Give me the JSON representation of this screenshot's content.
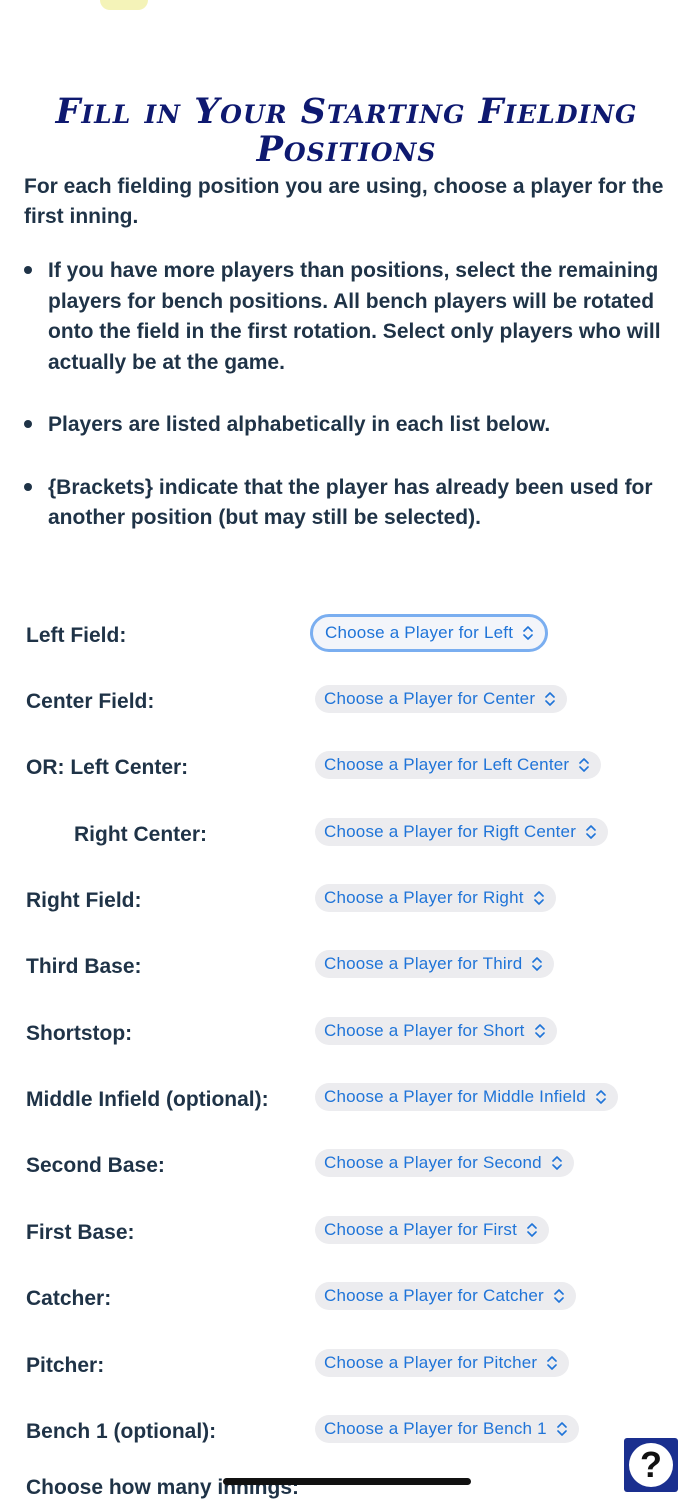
{
  "title": "Fill in Your Starting Fielding Positions",
  "intro": "For each fielding position you are using, choose a player for the first inning.",
  "notes": [
    "If you have more players than positions, select the remaining players for bench positions. All bench players will be rotated onto the field in the first rotation. Select only players who will actually be at the game.",
    "Players are listed alphabetically in each list below.",
    "{Brackets} indicate that the player has already been used for another position (but may still be selected)."
  ],
  "positions": [
    {
      "label": "Left Field:",
      "select": "Choose a Player for Left"
    },
    {
      "label": "Center Field:",
      "select": "Choose a Player for Center"
    },
    {
      "label": "OR: Left Center:",
      "select": "Choose a Player for Left Center"
    },
    {
      "label": "Right Center:",
      "select": "Choose a Player for Rigft Center"
    },
    {
      "label": "Right Field:",
      "select": "Choose a Player for Right"
    },
    {
      "label": "Third Base:",
      "select": "Choose a Player for Third"
    },
    {
      "label": "Shortstop:",
      "select": "Choose a Player for Short"
    },
    {
      "label": "Middle Infield (optional):",
      "select": "Choose a Player for Middle Infield"
    },
    {
      "label": "Second Base:",
      "select": "Choose a Player for Second"
    },
    {
      "label": "First Base:",
      "select": "Choose a Player for First"
    },
    {
      "label": "Catcher:",
      "select": "Choose a Player for Catcher"
    },
    {
      "label": "Pitcher:",
      "select": "Choose a Player for Pitcher"
    },
    {
      "label": "Bench 1 (optional):",
      "select": "Choose a Player for Bench 1"
    }
  ],
  "innings_label": "Choose how many innings:",
  "help": {
    "glyph": "?"
  },
  "colors": {
    "title": "#0e1970",
    "text": "#1f3347",
    "select_text": "#1f74d8",
    "select_bg": "#ececef",
    "focus_ring": "#7aaef0",
    "help_bg": "#1a2f8f"
  },
  "icons": {
    "select": "chevron-up-down-icon",
    "help": "question-mark-icon",
    "logo": "site-logo"
  }
}
